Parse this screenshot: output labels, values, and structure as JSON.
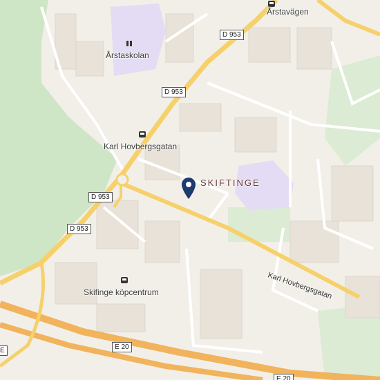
{
  "places": {
    "district": "SKIFTINGE",
    "school": "Årstaskolan",
    "stop_karl": "Karl Hovbergsgatan",
    "stop_center": "Skifinge köpcentrum",
    "stop_arsta": "Årstavägen",
    "street": "Karl Hovbergsgatan"
  },
  "roads": {
    "d953_a": "D 953",
    "d953_b": "D 953",
    "d953_c": "D 953",
    "d953_d": "D 953",
    "e20_a": "E 20",
    "e20_b": "E 20",
    "e20_c": "E"
  },
  "icons": {
    "pin": "location-pin-icon",
    "bus": "bus-stop-icon",
    "school": "school-icon"
  },
  "colors": {
    "background": "#f2efe9",
    "forest": "#cfe6c6",
    "park": "#dcebd4",
    "school_area": "#e4dcf5",
    "motorway": "#f1b35b",
    "trunk": "#f6d06b",
    "pin": "#1e3a6e"
  }
}
